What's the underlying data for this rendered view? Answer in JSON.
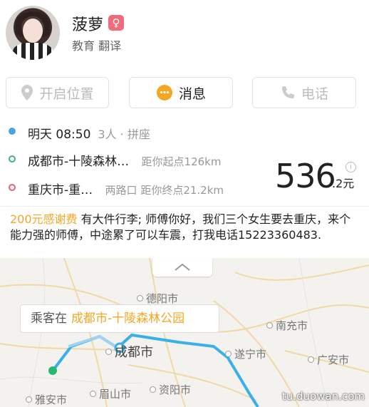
{
  "profile": {
    "name": "菠萝",
    "gender_symbol": "♀",
    "tags": "教育 翻译"
  },
  "actions": {
    "location_label": "开启位置",
    "message_label": "消息",
    "call_label": "电话"
  },
  "trip": {
    "time": "明天 08:50",
    "passengers": "3人 · 拼座",
    "from": "成都市-十陵森林…",
    "from_distance": "距你起点126km",
    "to": "重庆市-重…",
    "to_detail": "两路口 距你终点21.2km",
    "price_int": "536",
    "price_dec": ".2元",
    "info_symbol": "i"
  },
  "note": {
    "fee": "200元感谢费",
    "text": " 有大件行李; 师傅你好，我们三个女生要去重庆，来个能力强的师傅，中途累了可以车震，打我电话15223360483."
  },
  "map": {
    "pickup_prefix": "乘客在",
    "pickup_place": "成都市-十陵森林公园",
    "cities": {
      "deyang": "德阳市",
      "chengdu": "成都市",
      "nanchong": "南充市",
      "suining": "遂宁市",
      "guangan": "广安市",
      "yaan": "雅安市",
      "meishan": "眉山市",
      "ziyang": "资阳市"
    },
    "collapse_symbol": "︿"
  },
  "watermark": "tu.duowan.com",
  "colors": {
    "accent_orange": "#f5a623",
    "route_blue": "#3ab0e8",
    "gender_pink": "#f06c7a",
    "time_dot": "#4aa3df",
    "from_dot": "#3bb87a",
    "to_dot": "#e8606b"
  }
}
